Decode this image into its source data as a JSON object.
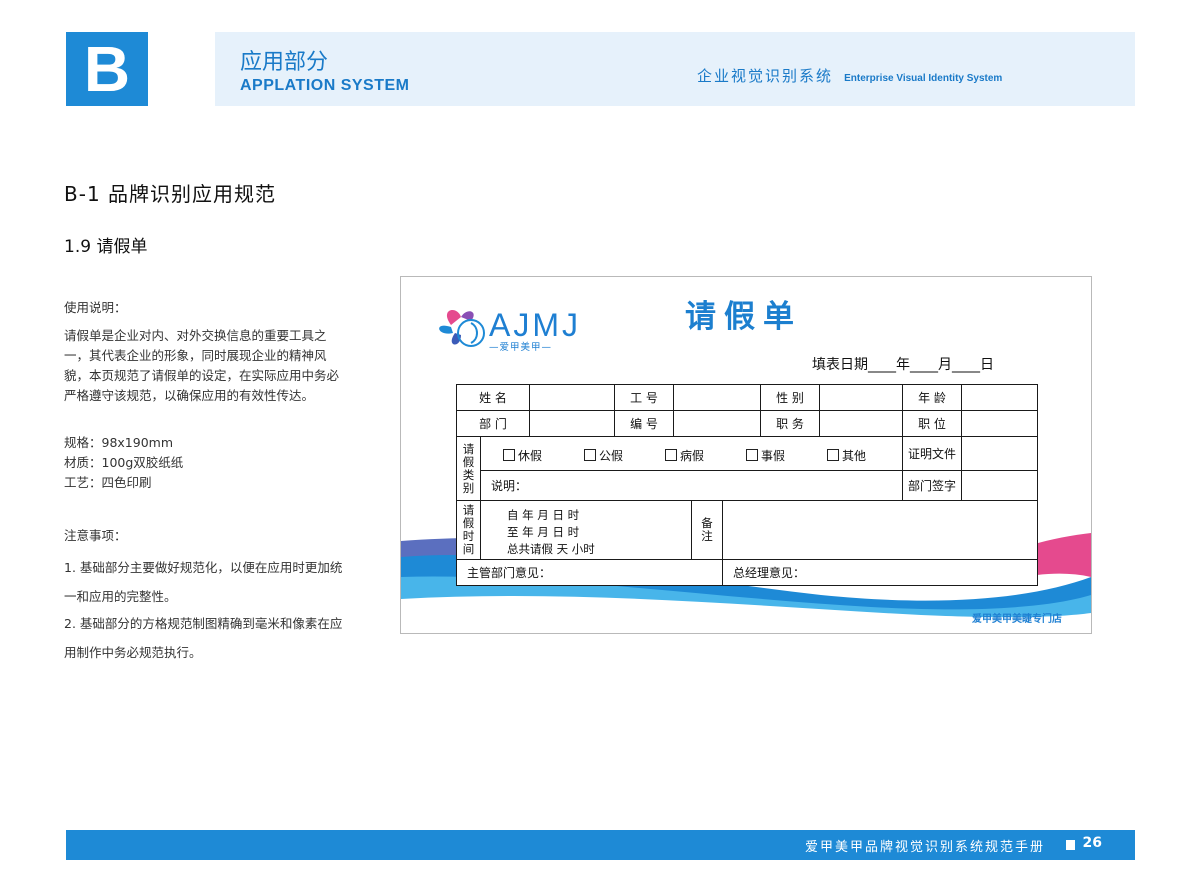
{
  "header": {
    "badge": "B",
    "title_cn": "应用部分",
    "title_en": "APPLATION SYSTEM",
    "right_cn": "企业视觉识别系统",
    "right_en": "Enterprise Visual Identity System"
  },
  "section_title": "B-1  品牌识别应用规范",
  "subsection_title": "1.9  请假单",
  "usage": {
    "heading": "使用说明：",
    "body": "请假单是企业对内、对外交换信息的重要工具之一，其代表企业的形象，同时展现企业的精神风貌，本页规范了请假单的设定，在实际应用中务必严格遵守该规范，以确保应用的有效性传达。",
    "spec_size": "规格：98x190mm",
    "spec_material": "材质：100g双胶纸纸",
    "spec_process": "工艺：四色印刷"
  },
  "notes": {
    "heading": "注意事项：",
    "items": [
      "1. 基础部分主要做好规范化，以便在应用时更加统一和应用的完整性。",
      "2. 基础部分的方格规范制图精确到毫米和像素在应用制作中务必规范执行。"
    ]
  },
  "form": {
    "logo_text": "AJMJ",
    "logo_sub": "—爱甲美甲—",
    "title": "请假单",
    "fill_date": "填表日期____年____月____日",
    "row1": [
      "姓 名",
      "工 号",
      "性 别",
      "年 龄"
    ],
    "row2": [
      "部 门",
      "编 号",
      "职 务",
      "职 位"
    ],
    "leave_type_label": [
      "请",
      "假",
      "类",
      "别"
    ],
    "leave_types": [
      "休假",
      "公假",
      "病假",
      "事假",
      "其他"
    ],
    "certificate": "证明文件",
    "explain": "说明：",
    "dept_sign": "部门签字",
    "leave_time_label": [
      "请",
      "假",
      "时",
      "间"
    ],
    "time_from": "自      年      月      日      时",
    "time_to": "至      年      月      日      时",
    "time_total": "总共请假      天      小时",
    "remark_label": [
      "备",
      "注"
    ],
    "manager_opinion": "主管部门意见：",
    "gm_opinion": "总经理意见：",
    "store_name": "爱甲美甲美睫专门店"
  },
  "footer": {
    "text": "爱甲美甲品牌视觉识别系统规范手册",
    "page": "26"
  },
  "colors": {
    "brand_blue": "#1e8ad6",
    "header_bg": "#e6f1fb",
    "pink_accent": "#e54a8e"
  }
}
